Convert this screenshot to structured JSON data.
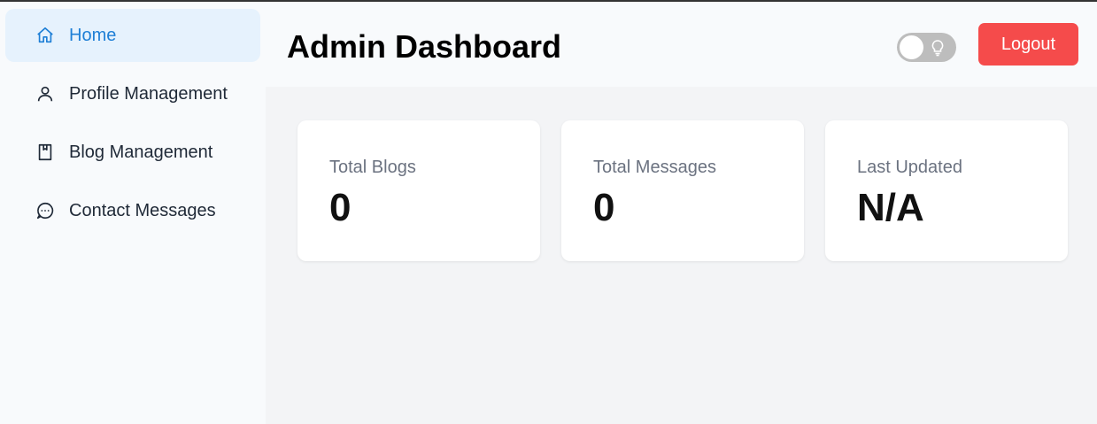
{
  "sidebar": {
    "items": [
      {
        "label": "Home",
        "icon": "home-icon",
        "active": true
      },
      {
        "label": "Profile Management",
        "icon": "user-icon",
        "active": false
      },
      {
        "label": "Blog Management",
        "icon": "book-icon",
        "active": false
      },
      {
        "label": "Contact Messages",
        "icon": "message-icon",
        "active": false
      }
    ]
  },
  "header": {
    "title": "Admin Dashboard",
    "theme_toggle": {
      "state": "off",
      "icon": "lightbulb-icon"
    },
    "logout_label": "Logout"
  },
  "stats": [
    {
      "label": "Total Blogs",
      "value": "0"
    },
    {
      "label": "Total Messages",
      "value": "0"
    },
    {
      "label": "Last Updated",
      "value": "N/A"
    }
  ],
  "colors": {
    "accent": "#1e7fd6",
    "active_bg": "#e6f2fd",
    "logout": "#f54b4b",
    "muted_text": "#6b7280"
  }
}
